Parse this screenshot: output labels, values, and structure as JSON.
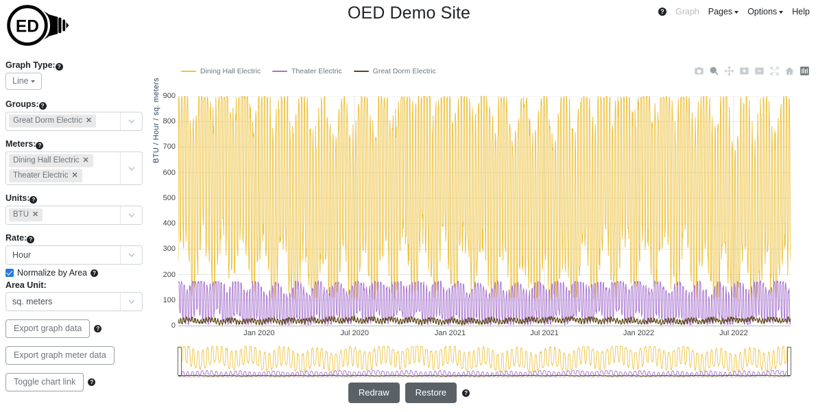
{
  "header": {
    "title": "OED Demo Site",
    "logo_text": "ED",
    "nav": [
      {
        "label": "Graph",
        "icon": "help-circle-icon",
        "state": "disabled",
        "has_caret": false
      },
      {
        "label": "Pages",
        "state": "normal",
        "has_caret": true
      },
      {
        "label": "Options",
        "state": "normal",
        "has_caret": true
      },
      {
        "label": "Help",
        "state": "normal",
        "has_caret": false
      }
    ]
  },
  "sidebar": {
    "graph_type": {
      "label": "Graph Type:",
      "value": "Line"
    },
    "groups": {
      "label": "Groups:",
      "chips": [
        "Great Dorm Electric"
      ]
    },
    "meters": {
      "label": "Meters:",
      "chips": [
        "Dining Hall Electric",
        "Theater Electric"
      ]
    },
    "units": {
      "label": "Units:",
      "chips": [
        "BTU"
      ]
    },
    "rate": {
      "label": "Rate:",
      "value": "Hour"
    },
    "normalize": {
      "label": "Normalize by Area",
      "checked": true
    },
    "area_unit": {
      "label": "Area Unit:",
      "value": "sq. meters"
    },
    "buttons": [
      {
        "label": "Export graph data",
        "has_help": true
      },
      {
        "label": "Export graph meter data",
        "has_help": false
      },
      {
        "label": "Toggle chart link",
        "has_help": true
      }
    ],
    "chip_remove_glyph": "✕"
  },
  "modebar": {
    "items": [
      "camera-icon",
      "zoom-icon",
      "pan-icon",
      "zoom-in-icon",
      "zoom-out-icon",
      "autoscale-icon",
      "reset-axes-icon",
      "toggle-spikelines-icon"
    ]
  },
  "footer": {
    "redraw_label": "Redraw",
    "restore_label": "Restore",
    "help_icon": "help-circle-icon"
  },
  "chart_data": {
    "type": "line",
    "title": "",
    "xlabel": "",
    "ylabel": "BTU / Hour / sq. meters",
    "ylim": [
      0,
      900
    ],
    "ytick_values": [
      0,
      100,
      200,
      300,
      400,
      500,
      600,
      700,
      800,
      900
    ],
    "ytick_labels": [
      "0",
      "100",
      "200",
      "300",
      "400",
      "500",
      "600",
      "700",
      "800",
      "900"
    ],
    "xtick_labels": [
      "Jan 2020",
      "Jul 2020",
      "Jan 2021",
      "Jul 2021",
      "Jan 2022",
      "Jul 2022"
    ],
    "xtick_positions": [
      0.132,
      0.288,
      0.444,
      0.598,
      0.752,
      0.907
    ],
    "xlim": [
      "Oct 2019",
      "Nov 2022"
    ],
    "grid": true,
    "legend_position": "top-left",
    "has_rangeslider": true,
    "series": [
      {
        "name": "Dining Hall Electric",
        "color": "#EDC240",
        "approx_range": [
          190,
          900
        ],
        "approx_mean": 540,
        "description": "dense hourly oscillation spanning roughly 200-900 BTU/Hour/sq. meters"
      },
      {
        "name": "Theater Electric",
        "color": "#A772CF",
        "approx_range": [
          5,
          175
        ],
        "approx_mean": 85,
        "description": "dense hourly oscillation spanning roughly 0-175 BTU/Hour/sq. meters"
      },
      {
        "name": "Great Dorm Electric",
        "color": "#5C4611",
        "approx_range": [
          5,
          35
        ],
        "approx_mean": 18,
        "description": "near-flat low band around 10-30 BTU/Hour/sq. meters"
      }
    ]
  }
}
